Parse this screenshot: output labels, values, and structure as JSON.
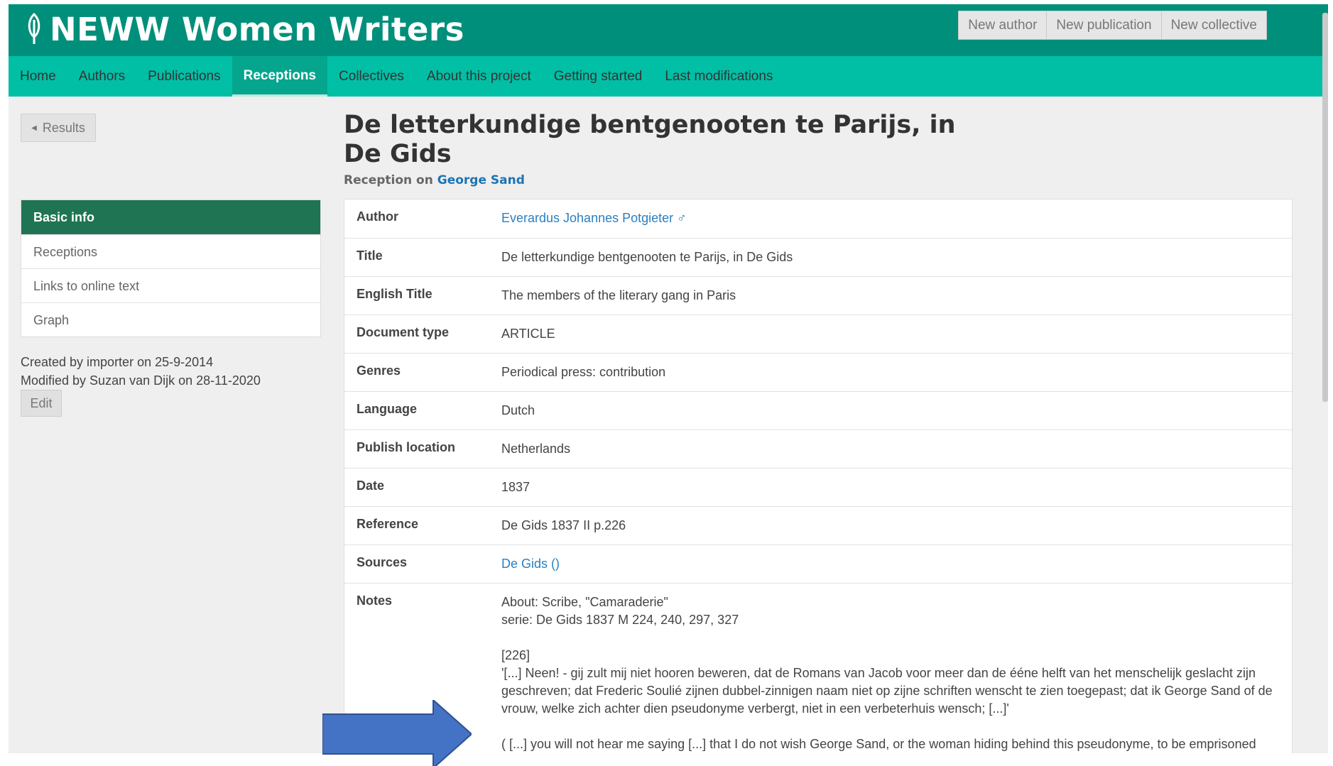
{
  "header": {
    "site_title": "NEWW Women Writers",
    "buttons": [
      "New author",
      "New publication",
      "New collective"
    ]
  },
  "nav": {
    "items": [
      "Home",
      "Authors",
      "Publications",
      "Receptions",
      "Collectives",
      "About this project",
      "Getting started",
      "Last modifications"
    ],
    "active": "Receptions"
  },
  "sidebar": {
    "results_label": "Results",
    "menu": [
      "Basic info",
      "Receptions",
      "Links to online text",
      "Graph"
    ],
    "created": "Created by importer on 25-9-2014",
    "modified": "Modified by Suzan van Dijk on 28-11-2020",
    "edit_label": "Edit"
  },
  "main": {
    "title": "De letterkundige bentgenooten te Parijs, in De Gids",
    "subtitle_prefix": "Reception on",
    "subtitle_link": "George Sand",
    "fields": {
      "author_label": "Author",
      "author_value": "Everardus Johannes Potgieter ♂",
      "title_label": "Title",
      "title_value": "De letterkundige bentgenooten te Parijs, in De Gids",
      "english_title_label": "English Title",
      "english_title_value": "The members of the literary gang in Paris",
      "document_type_label": "Document type",
      "document_type_value": "ARTICLE",
      "genres_label": "Genres",
      "genres_value": "Periodical press: contribution",
      "language_label": "Language",
      "language_value": "Dutch",
      "publish_location_label": "Publish location",
      "publish_location_value": "Netherlands",
      "date_label": "Date",
      "date_value": "1837",
      "reference_label": "Reference",
      "reference_value": "De Gids 1837 II p.226",
      "sources_label": "Sources",
      "sources_value": "De Gids ()",
      "notes_label": "Notes",
      "notes_p1": "About: Scribe, \"Camaraderie\"\nserie: De Gids 1837 M 224, 240, 297, 327",
      "notes_p2": "[226]\n'[...] Neen! - gij zult mij niet hooren beweren, dat de Romans van Jacob voor meer dan de ééne helft van het menschelijk geslacht zijn geschreven; dat Frederic Soulié zijnen dubbel-zinnigen naam niet op zijne schriften wenscht te zien toegepast; dat ik George Sand of de vrouw, welke zich achter dien pseudonyme verbergt, niet in een verbeterhuis wensch; [...]'",
      "notes_p3": "( [...] you will not hear me saying [...] that I do not wish George Sand, or the woman hiding behind this pseudonyme, to be emprisoned  [...])"
    }
  },
  "colors": {
    "header_dark": "#008f7a",
    "nav_teal": "#00bfa5",
    "menu_active": "#1f7553",
    "link": "#2a7fc0",
    "arrow": "#4472c4"
  },
  "icons": [
    "quill-leaf-icon",
    "caret-left-icon",
    "arrow-right-icon"
  ]
}
